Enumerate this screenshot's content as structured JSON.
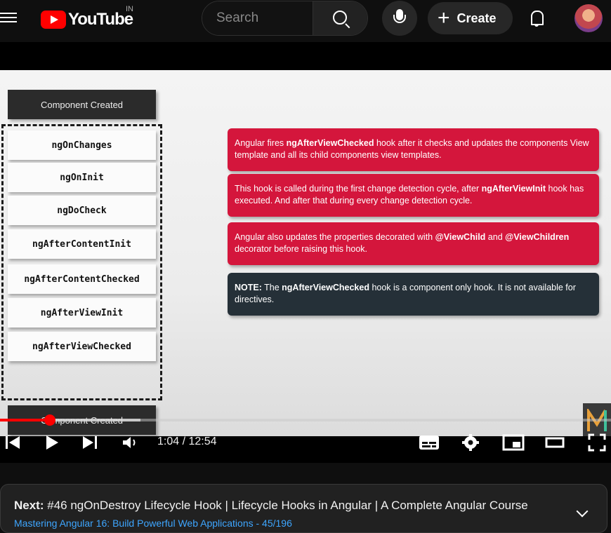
{
  "header": {
    "logo_text": "YouTube",
    "country_code": "IN",
    "search_placeholder": "Search",
    "create_label": "Create"
  },
  "slide": {
    "top_box": "Component Created",
    "bottom_box": "Component Created",
    "hooks": [
      "ngOnChanges",
      "ngOnInit",
      "ngDoCheck",
      "ngAfterContentInit",
      "ngAfterContentChecked",
      "ngAfterViewInit",
      "ngAfterViewChecked"
    ],
    "notes": [
      {
        "parts": [
          "Angular fires ",
          "ngAfterViewChecked",
          " hook after it checks and updates the components View template and all its child components view templates."
        ]
      },
      {
        "parts": [
          "This hook is called during the first change detection cycle, after ",
          "ngAfterViewInit",
          " hook has executed. And after that during every change detection cycle."
        ]
      },
      {
        "parts": [
          "Angular also updates the properties decorated with ",
          "@ViewChild",
          " and ",
          "@ViewChildren",
          " decorator before raising this hook."
        ]
      },
      {
        "parts": [
          "NOTE:",
          " The ",
          "ngAfterViewChecked",
          " hook is a component only hook. It is not available for directives."
        ]
      }
    ]
  },
  "player": {
    "progress_fraction": 0.0817,
    "current_time": "1:04",
    "duration": "12:54",
    "time_display": "1:04 / 12:54"
  },
  "up_next": {
    "label": "Next:",
    "title": "#46 ngOnDestroy Lifecycle Hook | Lifecycle Hooks in Angular | A Complete Angular Course",
    "playlist": "Mastering Angular 16: Build Powerful Web Applications - 45/196"
  },
  "colors": {
    "accent_red": "#ff0000",
    "note_red": "#d4163c",
    "note_dark": "#253038",
    "link_blue": "#3ea6ff"
  }
}
